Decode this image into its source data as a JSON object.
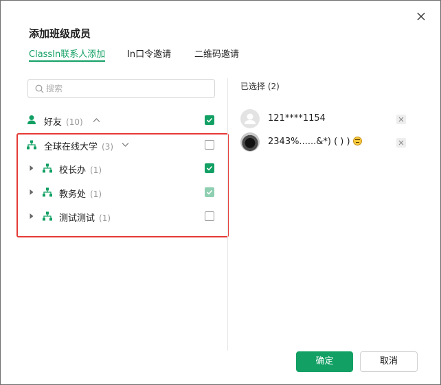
{
  "dialog": {
    "title": "添加班级成员",
    "close_icon": "close-icon"
  },
  "tabs": [
    {
      "label": "ClassIn联系人添加",
      "active": true
    },
    {
      "label": "In口令邀请",
      "active": false
    },
    {
      "label": "二维码邀请",
      "active": false
    }
  ],
  "search": {
    "placeholder": "搜索",
    "value": ""
  },
  "tree": {
    "friends": {
      "label": "好友",
      "count": "(10)",
      "icon": "user-icon",
      "expanded": true,
      "checked": true
    },
    "org": {
      "label": "全球在线大学",
      "count": "(3)",
      "icon": "org-icon",
      "expanded": true,
      "checked": false
    },
    "children": [
      {
        "label": "校长办",
        "count": "(1)",
        "state": "checked"
      },
      {
        "label": "教务处",
        "count": "(1)",
        "state": "checked-disabled"
      },
      {
        "label": "测试测试",
        "count": "(1)",
        "state": "unchecked"
      }
    ]
  },
  "selected": {
    "title": "已选择 (2)",
    "items": [
      {
        "name": "121****1154",
        "avatar": "default-avatar"
      },
      {
        "name": "2343%......&*)  ( )  )",
        "avatar": "photo-avatar",
        "emoji": "angry-face"
      }
    ]
  },
  "footer": {
    "confirm_label": "确定",
    "cancel_label": "取消"
  },
  "colors": {
    "accent": "#12a064",
    "highlight_border": "#e53935"
  }
}
